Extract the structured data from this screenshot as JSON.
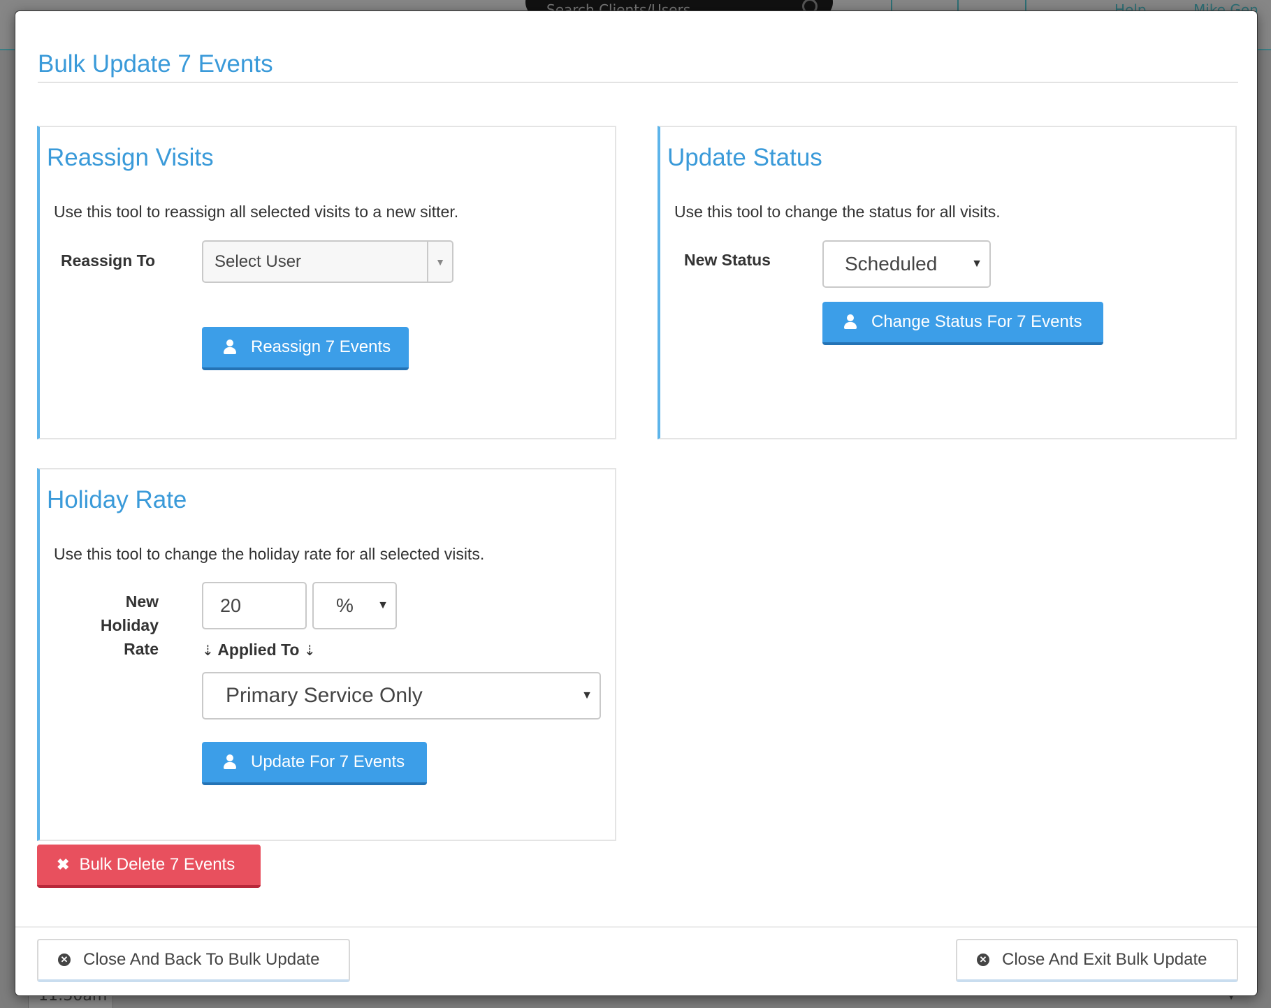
{
  "background": {
    "search_placeholder": "Search Clients/Users",
    "nav_help": "Help",
    "nav_user": "Mike Gen",
    "row_time": "11:30am"
  },
  "modal": {
    "title": "Bulk Update 7 Events"
  },
  "reassign": {
    "title": "Reassign Visits",
    "description": "Use this tool to reassign all selected visits to a new sitter.",
    "label": "Reassign To",
    "select_value": "Select User",
    "button_label": "Reassign 7 Events"
  },
  "status": {
    "title": "Update Status",
    "description": "Use this tool to change the status for all visits.",
    "label": "New Status",
    "select_value": "Scheduled",
    "button_label": "Change Status For 7 Events"
  },
  "holiday": {
    "title": "Holiday Rate",
    "description": "Use this tool to change the holiday rate for all selected visits.",
    "label_line1": "New",
    "label_line2": "Holiday",
    "label_line3": "Rate",
    "rate_value": "20",
    "unit_value": "%",
    "applied_label": "Applied To",
    "applied_value": "Primary Service Only",
    "button_label": "Update For 7 Events"
  },
  "delete_button_label": "Bulk Delete 7 Events",
  "footer": {
    "back_label": "Close And Back To Bulk Update",
    "exit_label": "Close And Exit Bulk Update"
  },
  "colors": {
    "accent": "#3a9ad9",
    "primary_button": "#3c9ee8",
    "danger_button": "#e8505e",
    "panel_border_accent": "#5db4ea"
  }
}
